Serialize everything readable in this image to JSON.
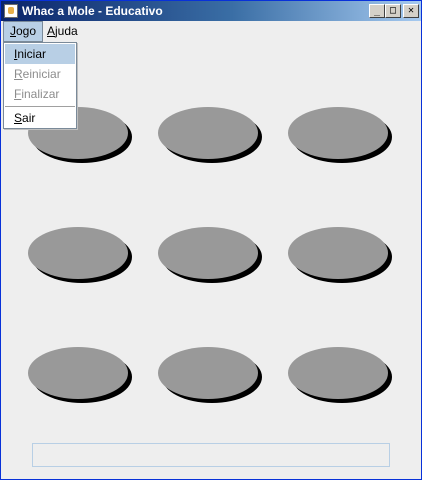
{
  "window": {
    "title": "Whac a Mole - Educativo",
    "controls": {
      "minimize": "_",
      "maximize": "□",
      "close": "✕"
    }
  },
  "menubar": {
    "jogo": {
      "first": "J",
      "rest": "ogo"
    },
    "ajuda": {
      "first": "A",
      "rest": "juda"
    }
  },
  "dropdown": {
    "iniciar": {
      "first": "I",
      "rest": "niciar",
      "enabled": true,
      "highlighted": true
    },
    "reiniciar": {
      "first": "R",
      "rest": "einiciar",
      "enabled": false
    },
    "finalizar": {
      "first": "F",
      "rest": "inalizar",
      "enabled": false
    },
    "sair": {
      "first": "S",
      "rest": "air",
      "enabled": true
    }
  },
  "board": {
    "rows": 3,
    "columns": 3,
    "hole_color": "#999999",
    "shadow_color": "#000000"
  },
  "status": {
    "text": ""
  },
  "colors": {
    "titlebar_start": "#0a246a",
    "titlebar_end": "#a6caf0",
    "menu_highlight": "#b8cfe5",
    "background": "#eeeeee"
  }
}
